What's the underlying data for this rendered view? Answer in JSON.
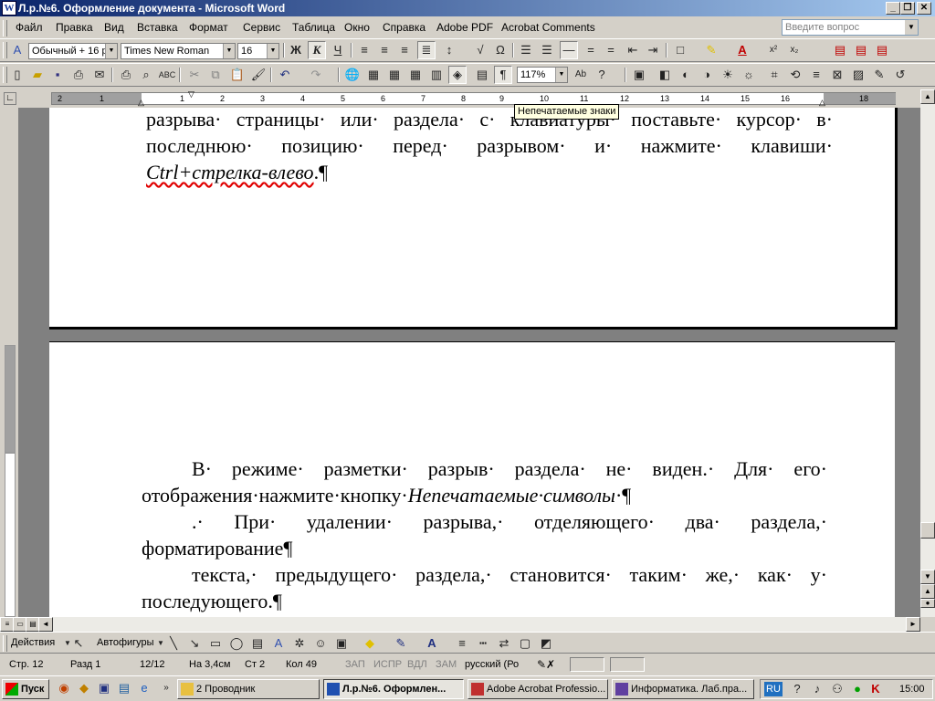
{
  "window": {
    "title": "Л.р.№6. Оформление документа - Microsoft Word",
    "app_icon": "W",
    "controls": [
      "_",
      "❐",
      "✕"
    ]
  },
  "menu": [
    "Файл",
    "Правка",
    "Вид",
    "Вставка",
    "Формат",
    "Сервис",
    "Таблица",
    "Окно",
    "Справка",
    "Adobe PDF",
    "Acrobat Comments"
  ],
  "help_box": {
    "placeholder": "Введите вопрос"
  },
  "formatting": {
    "style": "Обычный + 16 р",
    "font": "Times New Roman",
    "size": "16",
    "bold": "Ж",
    "italic": "К",
    "underline": "Ч"
  },
  "standard": {
    "zoom": "117%"
  },
  "tooltip": "Непечатаемые знаки",
  "ruler_numbers": [
    "2",
    "1",
    "1",
    "2",
    "3",
    "4",
    "5",
    "6",
    "7",
    "8",
    "9",
    "10",
    "11",
    "12",
    "13",
    "14",
    "15",
    "16",
    "18"
  ],
  "document": {
    "page1": [
      "разрыва· страницы· или· раздела· с· клавиатуры· поставьте· курсор· в·",
      "последнюю· позицию· перед· разрывом· и· нажмите· клавиши·",
      {
        "italic": "Ctrl+стрелка-влево",
        "tail": ".¶"
      }
    ],
    "page2": {
      "p1_line1": "В· режиме· разметки· разрыв· раздела· не· виден.· Для· его·",
      "p1_line2_normal": "отображения·нажмите·кнопку·",
      "p1_line2_italic": "Непечатаемые·символы",
      "p1_line2_tail": "·¶",
      "p2_line1": ".· При· удалении· разрыва,· отделяющего· два· раздела,·",
      "p2_line2": "форматирование¶",
      "p3_line1": "текста,· предыдущего· раздела,· становится· таким· же,· как· у·",
      "p3_line2": "последующего.¶"
    }
  },
  "drawing": {
    "actions": "Действия",
    "autoshapes": "Автофигуры"
  },
  "status": {
    "page": "Стр.  12",
    "section": "Разд  1",
    "pages": "12/12",
    "at": "На 3,4см",
    "line": "Ст  2",
    "col": "Кол  49",
    "rec": "ЗАП",
    "trk": "ИСПР",
    "ext": "ВДЛ",
    "ovr": "ЗАМ",
    "lang": "русский (Ро"
  },
  "taskbar": {
    "start": "Пуск",
    "tasks": [
      "2 Проводник",
      "Л.р.№6. Оформлен...",
      "Adobe Acrobat Professio...",
      "Информатика. Лаб.пра..."
    ],
    "lang": "RU",
    "time": "15:00"
  },
  "colors": {
    "title_start": "#0a246a",
    "title_end": "#a6caf0",
    "workspace": "#808080",
    "face": "#d4d0c8"
  }
}
